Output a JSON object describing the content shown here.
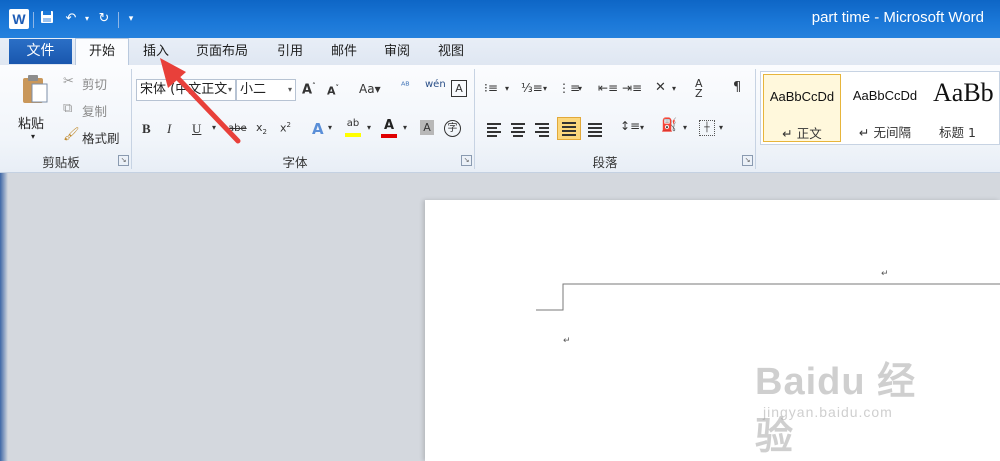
{
  "title_bar": {
    "window_title": "part time - Microsoft Word",
    "app_icon_letter": "W"
  },
  "tabs": {
    "file": "文件",
    "items": [
      "开始",
      "插入",
      "页面布局",
      "引用",
      "邮件",
      "审阅",
      "视图"
    ],
    "active": "开始"
  },
  "clipboard": {
    "paste": "粘贴",
    "cut": "剪切",
    "copy": "复制",
    "format_painter": "格式刷",
    "group_label": "剪贴板"
  },
  "font": {
    "font_name": "宋体 (中文正文",
    "font_size": "小二",
    "group_label": "字体"
  },
  "paragraph": {
    "group_label": "段落"
  },
  "styles": {
    "items": [
      {
        "sample": "AaBbCcDd",
        "name": "↵ 正文"
      },
      {
        "sample": "AaBbCcDd",
        "name": "↵ 无间隔"
      },
      {
        "sample": "AaBb",
        "name": "标题 1"
      }
    ]
  },
  "document": {
    "paragraph_mark": "↵"
  },
  "watermark": {
    "logo": "Baidu 经验",
    "url": "jingyan.baidu.com"
  },
  "colors": {
    "accent": "#1b78d8",
    "highlight": "#ffff00",
    "font_color": "#e00000",
    "annotation_arrow": "#e8403a"
  }
}
